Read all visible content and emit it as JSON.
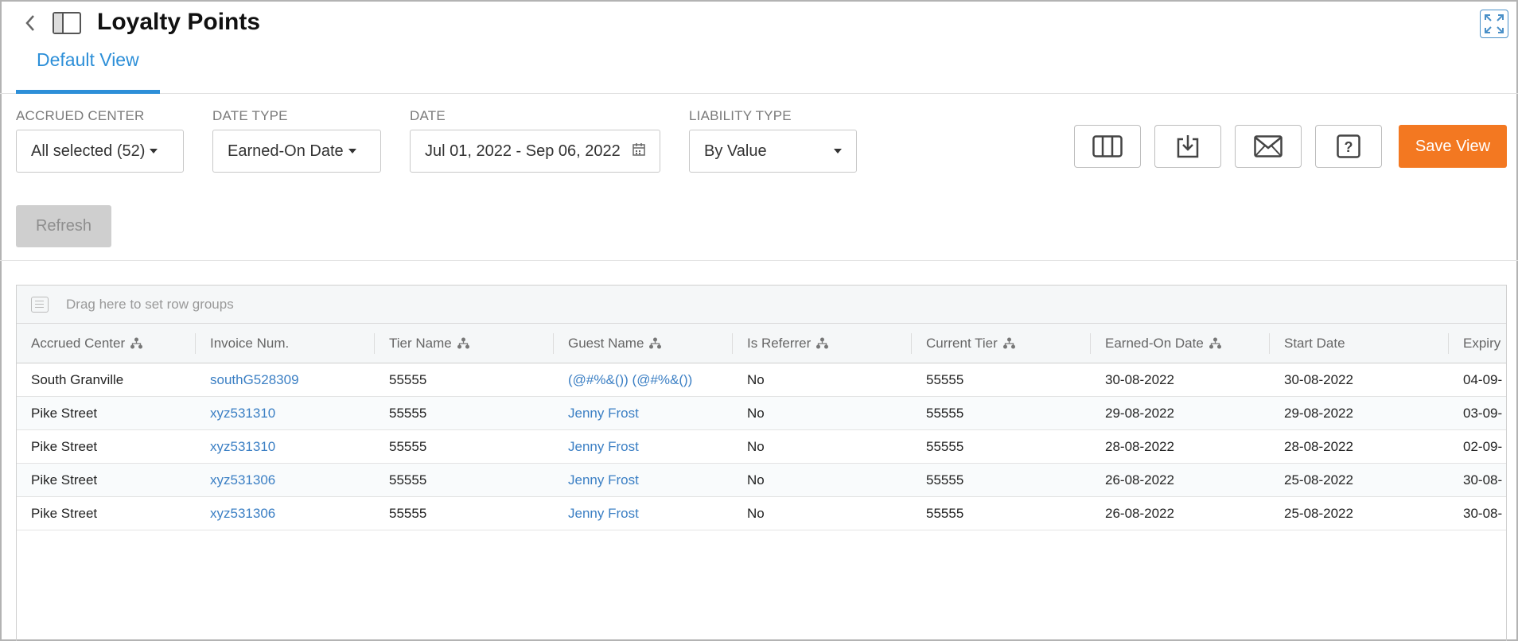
{
  "header": {
    "title": "Loyalty Points",
    "tab_label": "Default View"
  },
  "filters": {
    "accrued_center": {
      "label": "ACCRUED CENTER",
      "value": "All selected (52)"
    },
    "date_type": {
      "label": "DATE TYPE",
      "value": "Earned-On Date"
    },
    "date": {
      "label": "DATE",
      "value": "Jul 01, 2022 - Sep 06, 2022"
    },
    "liability_type": {
      "label": "LIABILITY TYPE",
      "value": "By Value"
    }
  },
  "toolbar": {
    "save_label": "Save View",
    "refresh_label": "Refresh"
  },
  "grid": {
    "group_placeholder": "Drag here to set row groups",
    "columns": [
      "Accrued Center",
      "Invoice Num.",
      "Tier Name",
      "Guest Name",
      "Is Referrer",
      "Current Tier",
      "Earned-On Date",
      "Start Date",
      "Expiry"
    ],
    "rows": [
      [
        "South Granville",
        "southG528309",
        "55555",
        "(@#%&()) (@#%&())",
        "No",
        "55555",
        "30-08-2022",
        "30-08-2022",
        "04-09-"
      ],
      [
        "Pike Street",
        "xyz531310",
        "55555",
        "Jenny Frost",
        "No",
        "55555",
        "29-08-2022",
        "29-08-2022",
        "03-09-"
      ],
      [
        "Pike Street",
        "xyz531310",
        "55555",
        "Jenny Frost",
        "No",
        "55555",
        "28-08-2022",
        "28-08-2022",
        "02-09-"
      ],
      [
        "Pike Street",
        "xyz531306",
        "55555",
        "Jenny Frost",
        "No",
        "55555",
        "26-08-2022",
        "25-08-2022",
        "30-08-"
      ],
      [
        "Pike Street",
        "xyz531306",
        "55555",
        "Jenny Frost",
        "No",
        "55555",
        "26-08-2022",
        "25-08-2022",
        "30-08-"
      ]
    ]
  },
  "colors": {
    "accent": "#2d8fd8",
    "save": "#f37821",
    "link": "#3b7fc4"
  }
}
